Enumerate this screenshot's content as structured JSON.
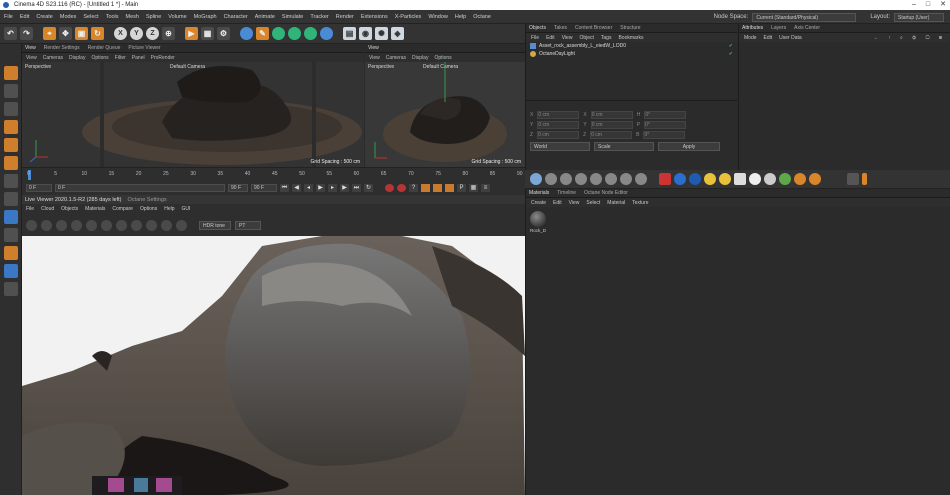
{
  "window": {
    "title": "Cinema 4D S23.116 (RC) - [Untitled 1 *] - Main"
  },
  "menubar": {
    "items": [
      "File",
      "Edit",
      "Create",
      "Modes",
      "Select",
      "Tools",
      "Mesh",
      "Spline",
      "Volume",
      "MoGraph",
      "Character",
      "Animate",
      "Simulate",
      "Tracker",
      "Render",
      "Extensions",
      "X-Particles",
      "Window",
      "Help",
      "Octane"
    ],
    "node_space_label": "Node Space:",
    "node_space_value": "Current (Standard/Physical)",
    "layout_label": "Layout:",
    "layout_value": "Startup (User)"
  },
  "toolbar": {
    "xyz": [
      "X",
      "Y",
      "Z"
    ]
  },
  "viewport_left": {
    "tabs": [
      "View",
      "Render Settings",
      "Render Queue",
      "Picture Viewer"
    ],
    "menu": [
      "View",
      "Cameras",
      "Display",
      "Options",
      "Filter",
      "Panel",
      "ProRender"
    ],
    "projection": "Perspective",
    "camera": "Default Camera",
    "grid_spacing": "Grid Spacing : 500 cm"
  },
  "viewport_right": {
    "tab": "View",
    "menu": [
      "View",
      "Cameras",
      "Display",
      "Options"
    ],
    "projection": "Perspective",
    "camera": "Default Camera",
    "grid_spacing": "Grid Spacing : 500 cm"
  },
  "timeline": {
    "ticks": [
      "0",
      "5",
      "10",
      "15",
      "20",
      "25",
      "30",
      "35",
      "40",
      "45",
      "50",
      "55",
      "60",
      "65",
      "70",
      "75",
      "80",
      "85",
      "90"
    ],
    "frame_ticks": [
      0,
      5,
      10,
      15,
      20,
      25,
      30,
      35,
      40,
      45,
      50,
      55,
      60,
      65,
      70,
      75,
      80,
      85,
      90
    ],
    "current_frame": "0 F",
    "start_frame": "0 F",
    "end_frame": "90 F",
    "max_frame": "90 F"
  },
  "live_viewer": {
    "title": "Live Viewer 2020.1.5-R2 (285 days left)",
    "settings_tab": "Octane Settings",
    "menu": [
      "File",
      "Cloud",
      "Objects",
      "Materials",
      "Compare",
      "Options",
      "Help",
      "GUI"
    ],
    "tonemap": "HDR tone",
    "channel": "PT"
  },
  "objects_panel": {
    "tabs": [
      "Objects",
      "Takes",
      "Content Browser",
      "Structure"
    ],
    "menu": [
      "File",
      "Edit",
      "View",
      "Object",
      "Tags",
      "Bookmarks"
    ],
    "objects": [
      {
        "name": "Asset_rock_assembly_L_eiedW_LOD0"
      },
      {
        "name": "OctaneDayLight"
      }
    ]
  },
  "coordinates": {
    "rows": [
      {
        "a": "X",
        "av": "0 cm",
        "b": "X",
        "bv": "0 cm",
        "c": "H",
        "cv": "0°"
      },
      {
        "a": "Y",
        "av": "0 cm",
        "b": "Y",
        "bv": "0 cm",
        "c": "P",
        "cv": "0°"
      },
      {
        "a": "Z",
        "av": "0 cm",
        "b": "Z",
        "bv": "0 cm",
        "c": "B",
        "cv": "0°"
      }
    ],
    "mode": "World",
    "scale": "Scale",
    "apply": "Apply"
  },
  "attributes_panel": {
    "tabs": [
      "Attributes",
      "Layers",
      "Axis Center"
    ],
    "menu": [
      "Mode",
      "Edit",
      "User Data"
    ]
  },
  "materials_panel": {
    "tabs": [
      "Materials",
      "Timeline",
      "Octane Node Editor"
    ],
    "menu": [
      "Create",
      "Edit",
      "View",
      "Select",
      "Material",
      "Texture"
    ],
    "materials": [
      {
        "name": "Rock_D"
      }
    ]
  },
  "colors": {
    "accent_orange": "#d9852a",
    "accent_blue": "#4a8bd6"
  }
}
